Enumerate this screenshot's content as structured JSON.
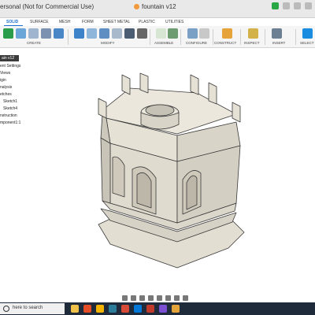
{
  "window": {
    "title": "ersonal (Not for Commercial Use)",
    "tab_label": "fountain v12"
  },
  "ribbon": {
    "tabs": [
      "SOLID",
      "SURFACE",
      "MESH",
      "FORM",
      "SHEET METAL",
      "PLASTIC",
      "UTILITIES"
    ],
    "active_tab": "SOLID",
    "groups": [
      "CREATE",
      "MODIFY",
      "ASSEMBLE",
      "CONFIGURE",
      "CONSTRUCT",
      "INSPECT",
      "INSERT",
      "SELECT"
    ]
  },
  "browser": {
    "nodes": [
      "ain v12",
      "ent Settings",
      "Views",
      "igin",
      "nalysis",
      "etches",
      "Sketch1",
      "Sketch4",
      "nstruction",
      "mponent1:1"
    ]
  },
  "taskbar": {
    "search_placeholder": "here to search"
  },
  "colors": {
    "accent": "#1a6fd1",
    "model_face": "#e3ded2",
    "model_edge": "#3a3a3a",
    "taskbar": "#1f2a3a"
  }
}
